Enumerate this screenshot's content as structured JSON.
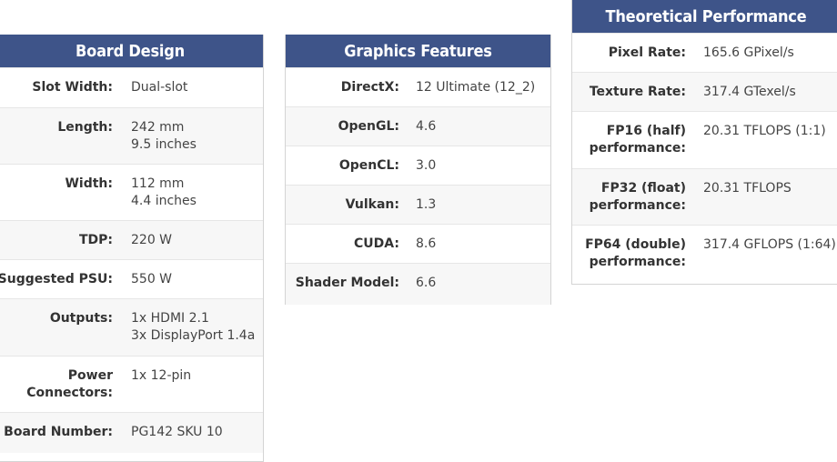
{
  "board_design": {
    "title": "Board Design",
    "rows": [
      {
        "label": "Slot Width:",
        "value": "Dual-slot"
      },
      {
        "label": "Length:",
        "value": "242 mm\n9.5 inches"
      },
      {
        "label": "Width:",
        "value": "112 mm\n4.4 inches"
      },
      {
        "label": "TDP:",
        "value": "220 W"
      },
      {
        "label": "Suggested PSU:",
        "value": "550 W"
      },
      {
        "label": "Outputs:",
        "value": "1x HDMI 2.1\n3x DisplayPort 1.4a"
      },
      {
        "label": "Power\nConnectors:",
        "value": "1x 12-pin"
      },
      {
        "label": "Board Number:",
        "value": "PG142 SKU 10"
      }
    ]
  },
  "graphics_features": {
    "title": "Graphics Features",
    "rows": [
      {
        "label": "DirectX:",
        "value": "12 Ultimate (12_2)"
      },
      {
        "label": "OpenGL:",
        "value": "4.6"
      },
      {
        "label": "OpenCL:",
        "value": "3.0"
      },
      {
        "label": "Vulkan:",
        "value": "1.3"
      },
      {
        "label": "CUDA:",
        "value": "8.6"
      },
      {
        "label": "Shader Model:",
        "value": "6.6"
      }
    ]
  },
  "theoretical_performance": {
    "title": "Theoretical Performance",
    "rows": [
      {
        "label": "Pixel Rate:",
        "value": "165.6 GPixel/s"
      },
      {
        "label": "Texture Rate:",
        "value": "317.4 GTexel/s"
      },
      {
        "label": "FP16 (half)\nperformance:",
        "value": "20.31 TFLOPS (1:1)"
      },
      {
        "label": "FP32 (float)\nperformance:",
        "value": "20.31 TFLOPS"
      },
      {
        "label": "FP64 (double)\nperformance:",
        "value": "317.4 GFLOPS (1:64)"
      }
    ]
  }
}
